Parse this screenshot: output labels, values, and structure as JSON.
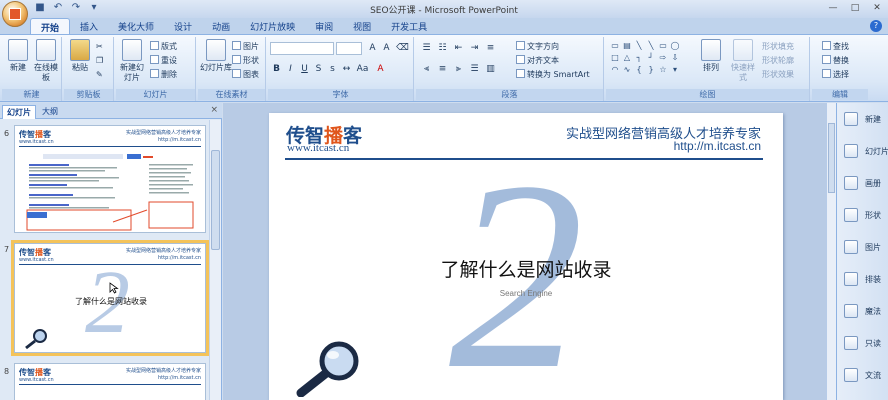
{
  "window": {
    "title": "SEO公开课 - Microsoft PowerPoint"
  },
  "tabs": [
    "开始",
    "插入",
    "美化大师",
    "设计",
    "动画",
    "幻灯片放映",
    "审阅",
    "视图",
    "开发工具"
  ],
  "ribbon": {
    "groups": {
      "new": "新建",
      "clipboard": "剪贴板",
      "slides": "幻灯片",
      "online": "在线素材",
      "font": "字体",
      "paragraph": "段落",
      "drawing": "绘图",
      "editing": "编辑"
    },
    "buttons": {
      "new": "新建",
      "online_template": "在线模板",
      "paste": "粘贴",
      "new_slide": "新建幻灯片",
      "layout": "版式",
      "reset": "重设",
      "delete": "删除",
      "slide_library": "幻灯片库",
      "image": "图片",
      "shape": "形状",
      "chart": "图表",
      "text_direction": "文字方向",
      "align_text": "对齐文本",
      "convert_smartart": "转换为 SmartArt",
      "arrange": "排列",
      "quick_styles": "快速样式",
      "shape_fill": "形状填充",
      "shape_outline": "形状轮廓",
      "shape_effects": "形状效果",
      "find": "查找",
      "replace": "替换",
      "select": "选择"
    }
  },
  "left_pane": {
    "tab_slides": "幻灯片",
    "tab_outline": "大纲",
    "close": "×",
    "slide_numbers": [
      "6",
      "7",
      "8"
    ],
    "thumb_title": "了解什么是网站收录"
  },
  "slide": {
    "logo_text_a": "传智",
    "logo_text_b": "播",
    "logo_text_c": "客",
    "logo_url": "www.itcast.cn",
    "tagline": "实战型网络营销高级人才培养专家",
    "url2": "http://m.itcast.cn",
    "big_number": "2",
    "title": "了解什么是网站收录",
    "subtitle": "Search Engine"
  },
  "right_bar": [
    "新建",
    "幻灯片",
    "画册",
    "形状",
    "图片",
    "排装",
    "魔法",
    "只读",
    "文流"
  ]
}
